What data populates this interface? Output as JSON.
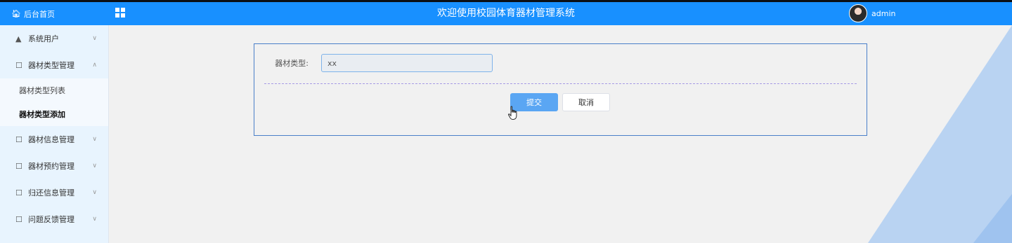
{
  "header": {
    "home_label": "后台首页",
    "home_icon": "home-icon",
    "menu_icon": "grid-icon",
    "title": "欢迎使用校园体育器材管理系统",
    "user_name": "admin"
  },
  "sidebar": {
    "items": [
      {
        "label": "系统用户",
        "icon": "user-icon",
        "expanded": false
      },
      {
        "label": "器材类型管理",
        "icon": "folder-icon",
        "expanded": true,
        "children": [
          {
            "label": "器材类型列表",
            "active": false
          },
          {
            "label": "器材类型添加",
            "active": true
          }
        ]
      },
      {
        "label": "器材信息管理",
        "icon": "folder-icon",
        "expanded": false
      },
      {
        "label": "器材预约管理",
        "icon": "folder-icon",
        "expanded": false
      },
      {
        "label": "归还信息管理",
        "icon": "folder-icon",
        "expanded": false
      },
      {
        "label": "问题反馈管理",
        "icon": "folder-icon",
        "expanded": false
      }
    ]
  },
  "form": {
    "field_label": "器材类型:",
    "field_value": "xx",
    "submit_label": "提交",
    "cancel_label": "取消"
  },
  "colors": {
    "primary": "#1890ff",
    "submit": "#5aa6f3",
    "card_border": "#4a7fc9"
  }
}
